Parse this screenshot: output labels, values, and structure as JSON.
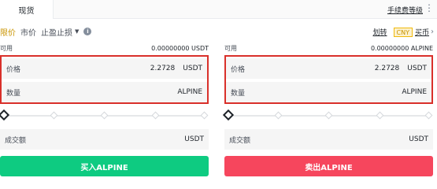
{
  "tabs": {
    "active": "现货"
  },
  "header": {
    "fee_link": "手续费等级"
  },
  "order_types": {
    "limit": "限价",
    "market": "市价",
    "stop": "止盈止损"
  },
  "toolbar": {
    "transfer": "划转",
    "currency": "CNY",
    "buy_crypto": "买币"
  },
  "buy": {
    "available_label": "可用",
    "available_value": "0.00000000 USDT",
    "price_label": "价格",
    "price_value": "2.2728",
    "price_unit": "USDT",
    "amount_label": "数量",
    "amount_unit": "ALPINE",
    "total_label": "成交额",
    "total_unit": "USDT",
    "button": "买入ALPINE"
  },
  "sell": {
    "available_label": "可用",
    "available_value": "0.00000000 ALPINE",
    "price_label": "价格",
    "price_value": "2.2728",
    "price_unit": "USDT",
    "amount_label": "数量",
    "amount_unit": "ALPINE",
    "total_label": "成交额",
    "total_unit": "USDT",
    "button": "卖出ALPINE"
  },
  "colors": {
    "accent": "#F0B90B",
    "buy": "#0ECB81",
    "sell": "#F6465D",
    "highlight_border": "#D9302A"
  }
}
